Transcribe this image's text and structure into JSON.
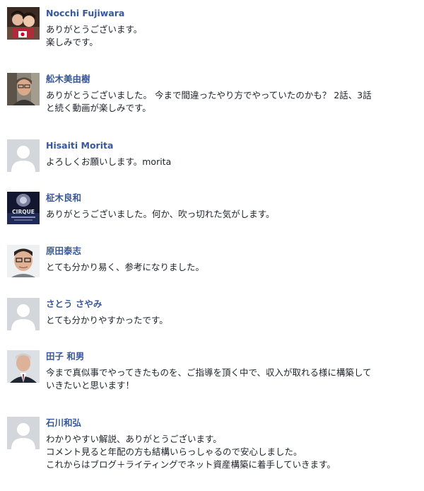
{
  "comments": [
    {
      "author": "Nocchi Fujiwara",
      "avatar_icon": "photo-avatar-mother-child-flag",
      "lines": [
        "ありがとうございます。",
        "楽しみです。"
      ]
    },
    {
      "author": "舩木美由樹",
      "avatar_icon": "photo-avatar-man-glasses",
      "lines": [
        "ありがとうございました。 今まで間違ったやり方でやっていたのかも？ 2話、3話",
        "と続く動画が楽しみです。"
      ]
    },
    {
      "author": "Hisaiti Morita",
      "avatar_icon": "default-avatar-silhouette",
      "lines": [
        "よろしくお願いします。morita"
      ]
    },
    {
      "author": "柾木良和",
      "avatar_icon": "photo-avatar-cirque",
      "avatar_text": "CIRQUE",
      "lines": [
        "ありがとうございました。何か、吹っ切れた気がします。"
      ]
    },
    {
      "author": "原田泰志",
      "avatar_icon": "photo-avatar-man-glasses",
      "lines": [
        "とても分かり易く、参考になりました。"
      ]
    },
    {
      "author": "さとう さやみ",
      "avatar_icon": "default-avatar-silhouette",
      "lines": [
        "とても分かりやすかったです。"
      ]
    },
    {
      "author": "田子 和男",
      "avatar_icon": "photo-avatar-man-suit",
      "lines": [
        "今まで真似事でやってきたものを、ご指導を頂く中で、収入が取れる様に構築して",
        "いきたいと思います！"
      ]
    },
    {
      "author": "石川和弘",
      "avatar_icon": "default-avatar-silhouette",
      "lines": [
        "わかりやすい解説、ありがとうございます。",
        "コメント見ると年配の方も結構いらっしゃるので安心しました。",
        "これからはブログ＋ライティングでネット資産構築に着手していきます。"
      ]
    }
  ]
}
